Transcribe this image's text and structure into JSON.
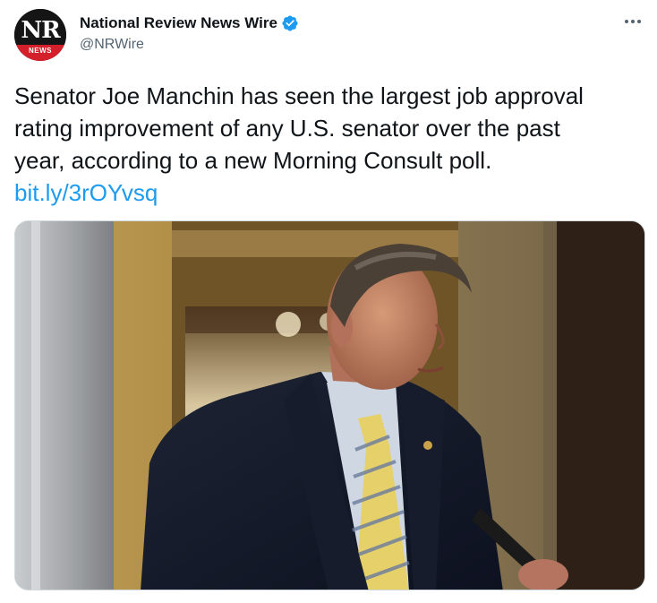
{
  "author": {
    "display_name": "National Review News Wire",
    "handle": "@NRWire",
    "avatar": {
      "top_text": "NR",
      "bottom_text": "NEWS",
      "top_color": "#151515",
      "bottom_color": "#d3202b"
    },
    "verified": true,
    "verified_color": "#1d9bf0"
  },
  "more_menu": {
    "icon": "more-horizontal-icon"
  },
  "tweet": {
    "lines": [
      "Senator Joe Manchin has seen the largest job approval",
      "rating improvement of any U.S. senator over the past",
      "year, according to a new Morning Consult poll."
    ],
    "link_text": "bit.ly/3rOYvsq",
    "link_color": "#1d9bf0"
  },
  "media": {
    "description_icon": "photo-of-senator-in-hallway"
  },
  "colors": {
    "text_primary": "#0f1419",
    "text_secondary": "#536471",
    "accent": "#1d9bf0"
  }
}
